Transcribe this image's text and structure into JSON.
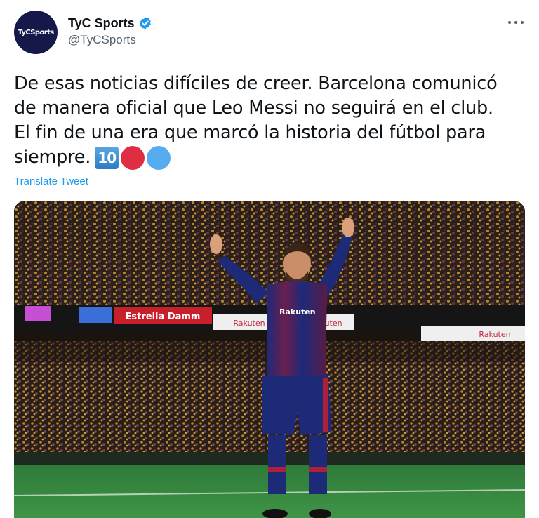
{
  "tweet": {
    "author": {
      "display_name": "TyC Sports",
      "handle": "@TyCSports",
      "avatar_text": "TyCSports",
      "verified": true,
      "avatar_color": "#15194a",
      "verified_color": "#1d9bf0"
    },
    "text_lines": [
      "De esas noticias difíciles de creer. Barcelona comunicó",
      "de manera oficial que Leo Messi no seguirá en el club.",
      "El fin de una era que marcó la historia del fútbol para",
      "siempre."
    ],
    "emojis": [
      "keycap-ten-icon",
      "red-circle-icon",
      "blue-circle-icon"
    ],
    "emoji_keycap_text": "10",
    "translate_label": "Translate Tweet",
    "more_icon": "more-options-icon",
    "media": {
      "description_icon": "stadium-photo",
      "billboards": [
        "Estrella Damm",
        "Rakuten",
        "Rakuten",
        "Rakuten"
      ],
      "shirt_sponsor": "Rakuten"
    }
  },
  "colors": {
    "text": "#0f1419",
    "secondary_text": "#536471",
    "link": "#1d9bf0"
  }
}
